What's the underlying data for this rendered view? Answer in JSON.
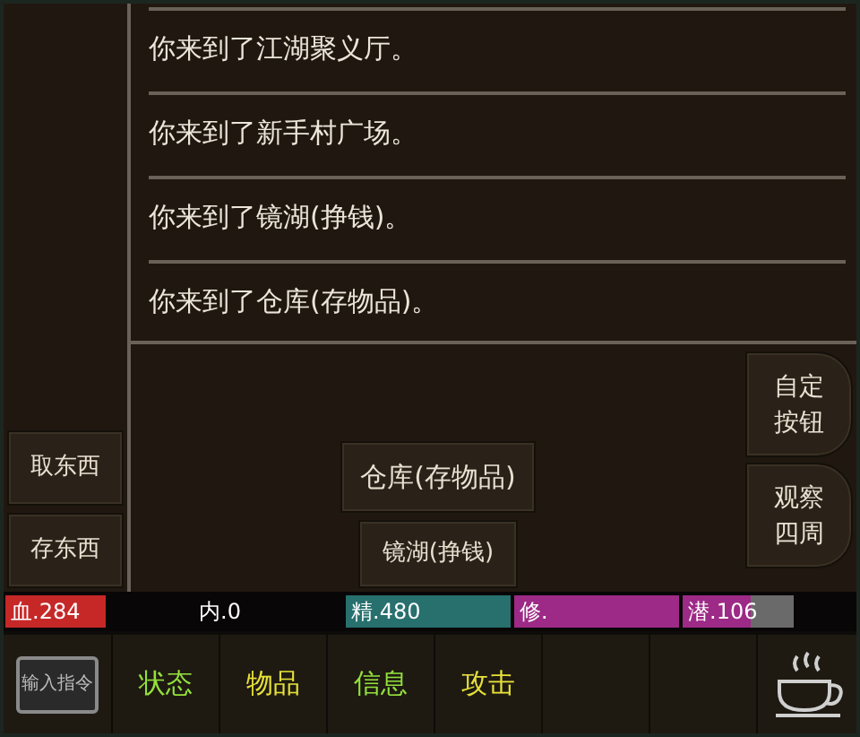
{
  "log": [
    "你来到了江湖聚义厅。",
    "你来到了新手村广场。",
    "你来到了镜湖(挣钱)。",
    "你来到了仓库(存物品)。"
  ],
  "side_buttons": [
    "取东西",
    "存东西"
  ],
  "exits": [
    "仓库(存物品)",
    "镜湖(挣钱)"
  ],
  "right_buttons": [
    "自定按钮",
    "观察四周"
  ],
  "stats": [
    {
      "label": "血.284",
      "color": "#c62828"
    },
    {
      "label": "内.0"
    },
    {
      "label": "精.480",
      "color": "#27706e"
    },
    {
      "label": "修.",
      "color": "#9c2a86"
    },
    {
      "label": "潜.106",
      "level": 0.62,
      "color": "#9c2a86"
    }
  ],
  "command_button": "输入指令",
  "tabs": [
    {
      "label": "状态",
      "color": "#93e03c"
    },
    {
      "label": "物品",
      "color": "#e6e03a"
    },
    {
      "label": "信息",
      "color": "#93e03c"
    },
    {
      "label": "攻击",
      "color": "#e6e03a"
    }
  ]
}
